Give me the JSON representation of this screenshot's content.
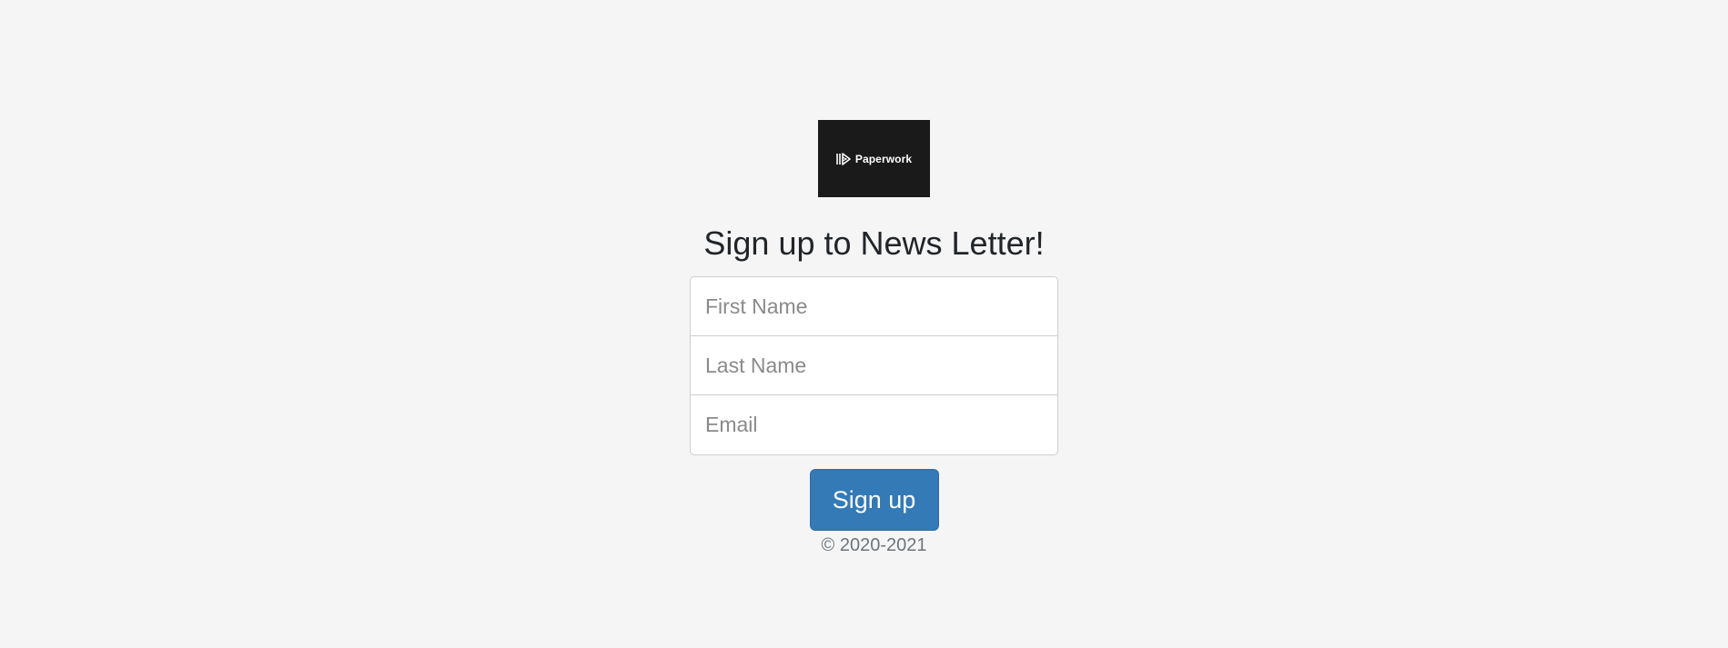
{
  "logo": {
    "text": "Paperwork",
    "icon": "paperwork-logo-icon",
    "background": "#1a1a1a"
  },
  "heading": "Sign up to News Letter!",
  "form": {
    "first_name": {
      "placeholder": "First Name",
      "value": ""
    },
    "last_name": {
      "placeholder": "Last Name",
      "value": ""
    },
    "email": {
      "placeholder": "Email",
      "value": ""
    }
  },
  "submit": {
    "label": "Sign up",
    "color": "#337ab7"
  },
  "footer": {
    "copyright": "© 2020-2021"
  }
}
